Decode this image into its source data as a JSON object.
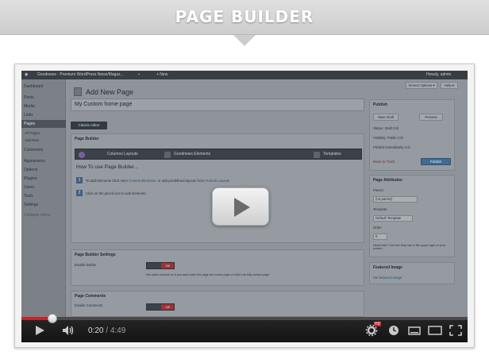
{
  "banner": {
    "title": "PAGE BUILDER"
  },
  "admin_bar": {
    "site": "Goodnews - Premium WordPress News/Magaz...",
    "new_label": "+ New",
    "howdy": "Howdy, admin"
  },
  "screen_options": {
    "screen_options_label": "Screen Options ▾",
    "help_label": "Help ▾"
  },
  "sidebar": {
    "items": [
      {
        "label": "Dashboard"
      },
      {
        "label": "Posts"
      },
      {
        "label": "Media"
      },
      {
        "label": "Links"
      },
      {
        "label": "Pages"
      },
      {
        "label": "All Pages"
      },
      {
        "label": "Add New"
      },
      {
        "label": "Comments"
      },
      {
        "label": "Appearance"
      },
      {
        "label": "Options"
      },
      {
        "label": "Plugins"
      },
      {
        "label": "Users"
      },
      {
        "label": "Tools"
      },
      {
        "label": "Settings"
      },
      {
        "label": "Collapse menu"
      }
    ]
  },
  "editor": {
    "heading": "Add New Page",
    "title_value": "My Custom home page",
    "classic_editor_label": "Classic editor"
  },
  "page_builder": {
    "heading": "Page Builder",
    "toolbar": {
      "columns": "Columns Layouts",
      "elements": "Goodnews Elements",
      "templates": "Templates"
    },
    "howto": "How To use Page Builder...",
    "step1": "To add Elements Click Here",
    "step1_link1": "Content Elements",
    "step1_mid": ", or add predefined layouts from",
    "step1_link2": "Prebuilt Layouts",
    "step2": "Click on the pencil icon to edit elements"
  },
  "builder_settings": {
    "heading": "Page Builder Settings",
    "enable_label": "Enable builder",
    "toggle_label": "Off",
    "hint": "this option must be on if you want make this page as a home page or build it as fully custom page"
  },
  "comments_box": {
    "heading": "Page Comments",
    "enable_label": "Enable Comments",
    "toggle_label": "Off"
  },
  "publish": {
    "heading": "Publish",
    "save_draft": "Save Draft",
    "preview": "Preview",
    "status": "Status: Draft",
    "visibility": "Visibility: Public",
    "publish_time": "Publish immediately",
    "edit": "Edit",
    "trash": "Move to Trash",
    "publish_btn": "Publish"
  },
  "attributes": {
    "heading": "Page Attributes",
    "parent_label": "Parent",
    "parent_value": "(no parent)",
    "template_label": "Template",
    "template_value": "Default Template",
    "order_label": "Order",
    "order_value": "0",
    "help": "Need help? Use the Help tab in the upper right of your screen."
  },
  "featured": {
    "heading": "Featured Image",
    "link": "Set featured image"
  },
  "player": {
    "current_time": "0:20",
    "separator": "/",
    "duration": "4:49",
    "progress": 0.069,
    "hd_badge": "HD"
  },
  "colors": {
    "progress": "#c6232a",
    "admin_bar": "#3a3e44",
    "toolbar": "#3a4149"
  }
}
